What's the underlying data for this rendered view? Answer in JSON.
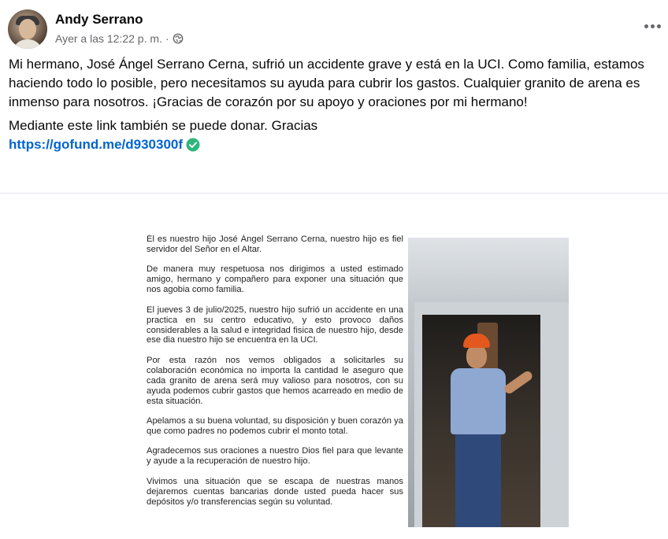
{
  "post": {
    "author": "Andy Serrano",
    "timestamp": "Ayer a las 12:22 p. m.",
    "separator": "·",
    "paragraph_1": "Mi hermano, José Ángel Serrano Cerna, sufrió un accidente grave y está en la UCI. Como familia, estamos haciendo todo lo posible, pero necesitamos su ayuda para cubrir los gastos. Cualquier granito de arena es inmenso para nosotros. ¡Gracias de corazón por su apoyo y oraciones por mi hermano!",
    "paragraph_2": "Mediante este link también se puede donar. Gracias",
    "link": "https://gofund.me/d930300f",
    "icons": {
      "privacy": "globe-icon",
      "more": "more-options-icon",
      "link_badge": "verified-check-icon"
    },
    "colors": {
      "link": "#0064d1",
      "badge": "#2eb67d",
      "meta": "#65676b"
    }
  },
  "letter": {
    "paragraphs": [
      "Él es nuestro hijo José Ángel Serrano Cerna, nuestro hijo es fiel servidor del Señor en el Altar.",
      "De manera muy respetuosa nos dirigimos a usted estimado amigo, hermano y compañero para exponer una situación que nos agobia como familia.",
      "El jueves 3 de julio/2025, nuestro hijo sufrió un accidente en una practica en su centro educativo, y esto provoco daños considerables a la salud e integridad fisica de nuestro hijo, desde ese dia nuestro hijo se encuentra en la UCI.",
      "Por esta razón nos vemos obligados a solicitarles su colaboración económica no importa la cantidad le aseguro que cada granito de arena será muy valioso para nosotros, con su ayuda podemos cubrir gastos que hemos acarreado en medio de esta situación.",
      "Apelamos a su buena voluntad, su disposición y buen corazón ya que como padres no podemos cubrir el monto total.",
      "Agradecemos sus oraciones a nuestro Dios fiel para que levante y ayude a la recuperación de nuestro hijo.",
      "Vivimos una situación que se escapa de nuestras manos dejaremos cuentas bancarias donde usted pueda hacer sus depósitos y/o transferencias según su voluntad."
    ]
  }
}
